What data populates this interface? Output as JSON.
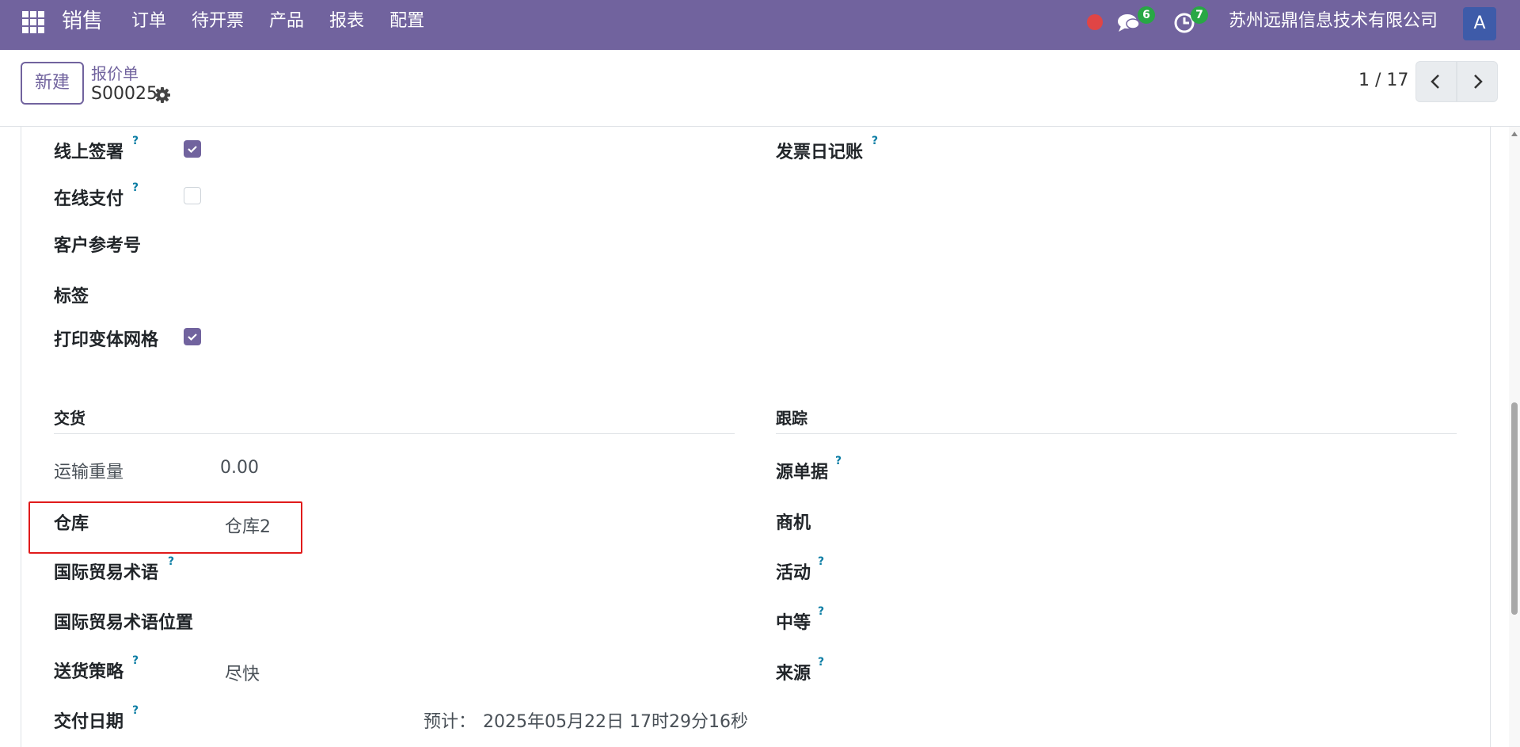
{
  "nav": {
    "brand": "销售",
    "menu": [
      "订单",
      "待开票",
      "产品",
      "报表",
      "配置"
    ],
    "messages_count": "6",
    "activities_count": "7",
    "company": "苏州远鼎信息技术有限公司",
    "avatar": "A"
  },
  "control": {
    "new_label": "新建",
    "breadcrumb_parent": "报价单",
    "breadcrumb_current": "S00025",
    "pager_value": "1 / 17"
  },
  "form": {
    "other_info": {
      "online_signature_label": "线上签署",
      "online_signature_checked": true,
      "online_payment_label": "在线支付",
      "online_payment_checked": false,
      "customer_ref_label": "客户参考号",
      "tags_label": "标签",
      "print_variant_grid_label": "打印变体网格",
      "print_variant_grid_checked": true,
      "invoice_journal_label": "发票日记账"
    },
    "delivery": {
      "section_title": "交货",
      "shipping_weight_label": "运输重量",
      "shipping_weight_value": "0.00",
      "warehouse_label": "仓库",
      "warehouse_value": "仓库2",
      "incoterm_label": "国际贸易术语",
      "incoterm_location_label": "国际贸易术语位置",
      "shipping_policy_label": "送货策略",
      "shipping_policy_value": "尽快",
      "commitment_date_label": "交付日期",
      "expected_label": "预计：",
      "expected_value": "2025年05月22日 17时29分16秒"
    },
    "tracking": {
      "section_title": "跟踪",
      "source_document_label": "源单据",
      "opportunity_label": "商机",
      "campaign_label": "活动",
      "medium_label": "中等",
      "source_label": "来源"
    },
    "help_mark": "?"
  },
  "colors": {
    "brand": "#71639e",
    "highlight": "#e01b1b",
    "badge": "#28a745",
    "help": "#0d7ea5"
  }
}
